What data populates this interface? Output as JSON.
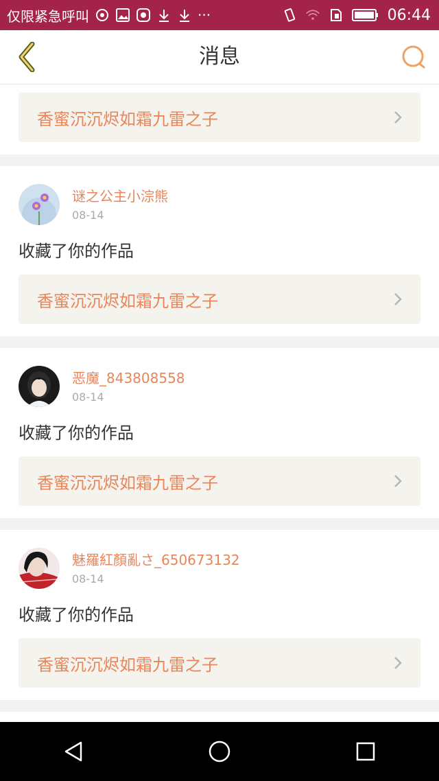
{
  "status_bar": {
    "carrier": "仅限紧急呼叫",
    "time": "06:44",
    "overflow": "···",
    "background": "#a3234a"
  },
  "header": {
    "title": "消息",
    "accent": "#e8865a"
  },
  "first_card": {
    "work_title": "香蜜沉沉烬如霜九雷之子"
  },
  "notifications": [
    {
      "username": "谜之公主小淙熊",
      "date": "08-14",
      "action": "收藏了你的作品",
      "work_title": "香蜜沉沉烬如霜九雷之子",
      "avatar": "flower-avatar"
    },
    {
      "username": "恶魔_843808558",
      "date": "08-14",
      "action": "收藏了你的作品",
      "work_title": "香蜜沉沉烬如霜九雷之子",
      "avatar": "girl-avatar"
    },
    {
      "username": "魅羅紅顏亂さ_650673132",
      "date": "08-14",
      "action": "收藏了你的作品",
      "work_title": "香蜜沉沉烬如霜九雷之子",
      "avatar": "red-portrait-avatar"
    }
  ]
}
